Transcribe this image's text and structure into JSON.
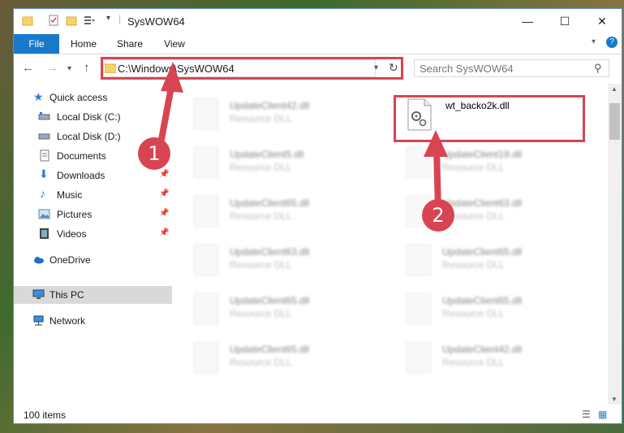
{
  "window": {
    "title": "SysWOW64",
    "controls": {
      "minimize": "—",
      "maximize": "☐",
      "close": "✕"
    }
  },
  "ribbon": {
    "tabs": [
      {
        "label": "File",
        "active": true
      },
      {
        "label": "Home"
      },
      {
        "label": "Share"
      },
      {
        "label": "View"
      }
    ],
    "help": "?"
  },
  "address": {
    "path": "C:\\Windows\\SysWOW64",
    "search_placeholder": "Search SysWOW64"
  },
  "sidebar": {
    "items": [
      {
        "label": "Quick access",
        "icon": "star-icon"
      },
      {
        "label": "Local Disk (C:)",
        "icon": "drive-icon"
      },
      {
        "label": "Local Disk (D:)",
        "icon": "drive-icon"
      },
      {
        "label": "Documents",
        "icon": "documents-icon"
      },
      {
        "label": "Downloads",
        "icon": "download-icon",
        "pinned": true
      },
      {
        "label": "Music",
        "icon": "music-icon",
        "pinned": true
      },
      {
        "label": "Pictures",
        "icon": "pictures-icon",
        "pinned": true
      },
      {
        "label": "Videos",
        "icon": "videos-icon",
        "pinned": true
      },
      {
        "label": "OneDrive",
        "icon": "cloud-icon"
      },
      {
        "label": "This PC",
        "icon": "pc-icon",
        "selected": true
      },
      {
        "label": "Network",
        "icon": "network-icon"
      }
    ]
  },
  "files": {
    "highlighted": {
      "name": "wt_backo2k.dll",
      "type": ""
    },
    "left_column": [
      {
        "name": "UpdateClient42.dll",
        "type": "Resource DLL"
      },
      {
        "name": "UpdateClient5.dll",
        "type": "Resource DLL"
      },
      {
        "name": "UpdateClient65.dll",
        "type": "Resource DLL"
      },
      {
        "name": "UpdateClient63.dll",
        "type": "Resource DLL"
      },
      {
        "name": "UpdateClient65.dll",
        "type": "Resource DLL"
      },
      {
        "name": "UpdateClient65.dll",
        "type": "Resource DLL"
      }
    ],
    "right_column": [
      {
        "name": "UpdateClient19.dll",
        "type": "Resource DLL"
      },
      {
        "name": "UpdateClient63.dll",
        "type": "Resource DLL"
      },
      {
        "name": "UpdateClient65.dll",
        "type": "Resource DLL"
      },
      {
        "name": "UpdateClient65.dll",
        "type": "Resource DLL"
      },
      {
        "name": "UpdateClient42.dll",
        "type": "Resource DLL"
      }
    ]
  },
  "status": {
    "item_count": "100 items"
  },
  "annotations": {
    "step1": "1",
    "step2": "2",
    "color": "#d94452"
  },
  "colors": {
    "accent": "#1979ca",
    "highlight": "#d94452"
  }
}
